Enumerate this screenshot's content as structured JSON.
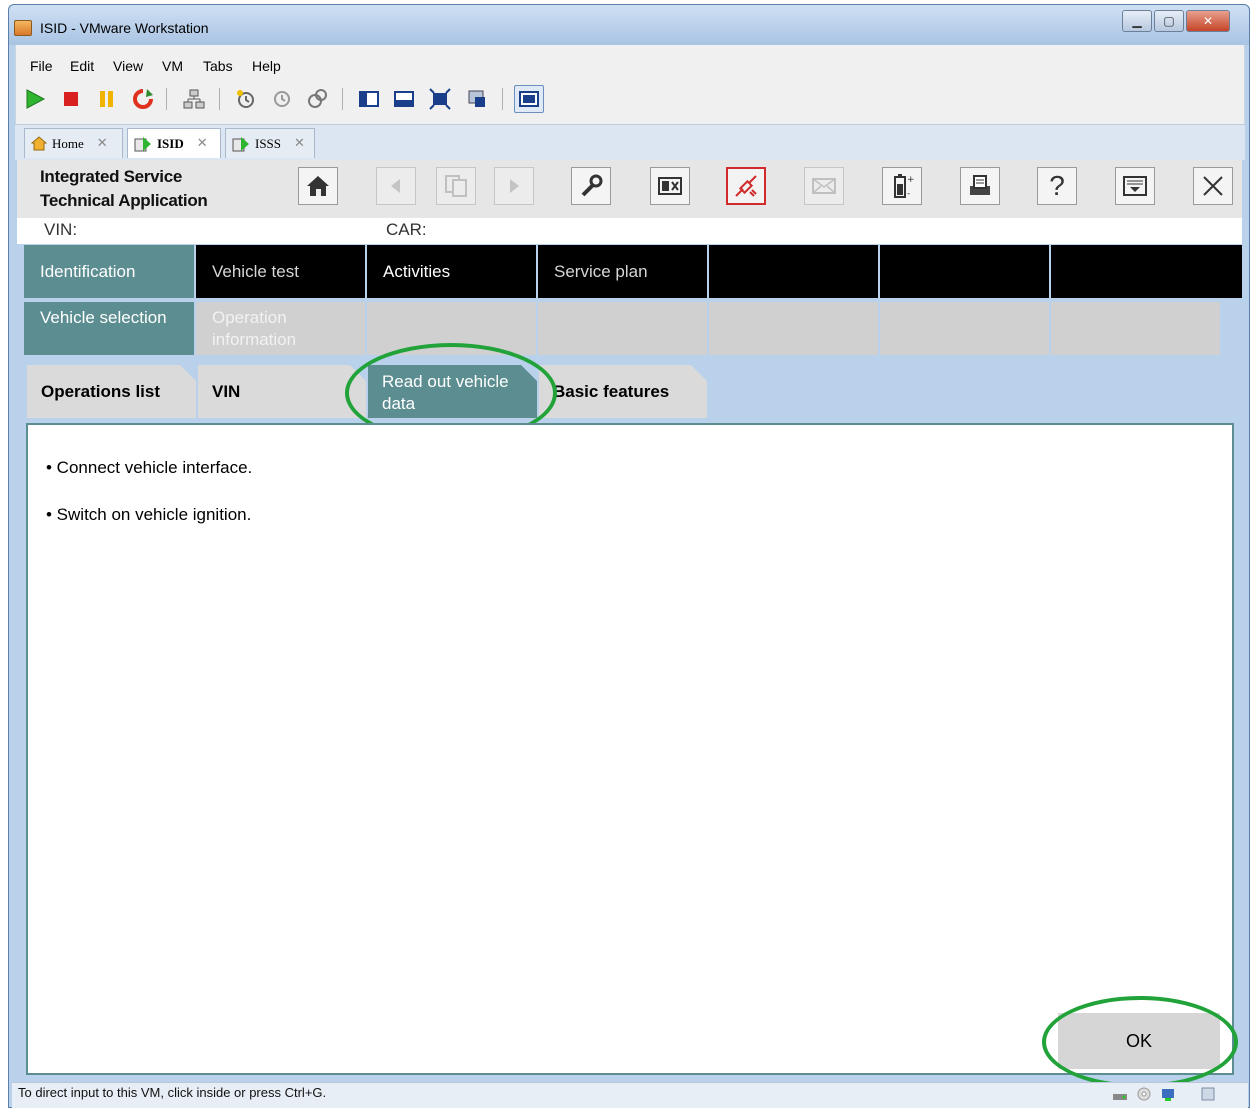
{
  "window": {
    "title": "ISID - VMware Workstation"
  },
  "menubar": [
    "File",
    "Edit",
    "View",
    "VM",
    "Tabs",
    "Help"
  ],
  "vm_tabs": [
    {
      "label": "Home",
      "icon": "home-icon",
      "active": false
    },
    {
      "label": "ISID",
      "icon": "vm-icon",
      "active": true
    },
    {
      "label": "ISSS",
      "icon": "vm-icon",
      "active": false
    }
  ],
  "app": {
    "title_line1": "Integrated Service",
    "title_line2": "Technical Application",
    "vin_label": "VIN:",
    "car_label": "CAR:"
  },
  "nav_main": [
    "Identification",
    "Vehicle test",
    "Activities",
    "Service plan",
    "",
    "",
    ""
  ],
  "nav_sub": [
    "Vehicle selection",
    "Operation information",
    "",
    "",
    "",
    "",
    ""
  ],
  "sub_tabs": [
    "Operations list",
    "VIN",
    "Read out vehicle data",
    "Basic features"
  ],
  "content": {
    "lines": [
      "• Connect vehicle interface.",
      "• Switch on vehicle ignition."
    ],
    "ok_label": "OK"
  },
  "status": {
    "text": "To direct input to this VM, click inside or press Ctrl+G."
  },
  "colors": {
    "accent_teal": "#5c8e91",
    "annotation_green": "#21a33a",
    "nav_black": "#000000"
  }
}
